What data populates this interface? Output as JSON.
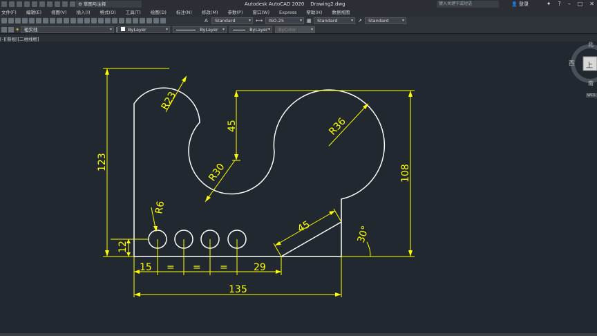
{
  "titlebar": {
    "workspace": "草图与注释",
    "app_name": "Autodesk AutoCAD 2020",
    "file_name": "Drawing2.dwg",
    "search_placeholder": "键入关键字或短语",
    "login": "登录"
  },
  "menu": [
    "文件(F)",
    "编辑(E)",
    "视图(V)",
    "插入(I)",
    "格式(O)",
    "工具(T)",
    "绘图(D)",
    "标注(N)",
    "修改(M)",
    "参数(P)",
    "窗口(W)",
    "Express",
    "帮助(H)",
    "数据视图"
  ],
  "toolbar1": {
    "text_style": "Standard",
    "dim_style": "ISO-25",
    "table_style": "Standard",
    "multileader_style": "Standard"
  },
  "toolbar2": {
    "layer": "粗实线",
    "color": "ByLayer",
    "linetype": "ByLayer",
    "lineweight": "ByLayer",
    "plotstyle": "ByColor"
  },
  "view_label": "[-][俯视][二维线框]",
  "viewcube": {
    "north": "北",
    "west": "西",
    "south": "南",
    "top": "上",
    "wcs": "WCS"
  },
  "colors": {
    "background": "#212830",
    "geometry": "#ffffff",
    "dimension": "#ffff00"
  },
  "dimensions": {
    "r23": "R23",
    "r30": "R30",
    "r36": "R36",
    "r6": "R6",
    "d45_vert": "45",
    "d123": "123",
    "d108": "108",
    "d12": "12",
    "d15": "15",
    "eq1": "=",
    "eq2": "=",
    "eq3": "=",
    "d29": "29",
    "d135": "135",
    "d45_slant": "45",
    "a30": "30°"
  }
}
